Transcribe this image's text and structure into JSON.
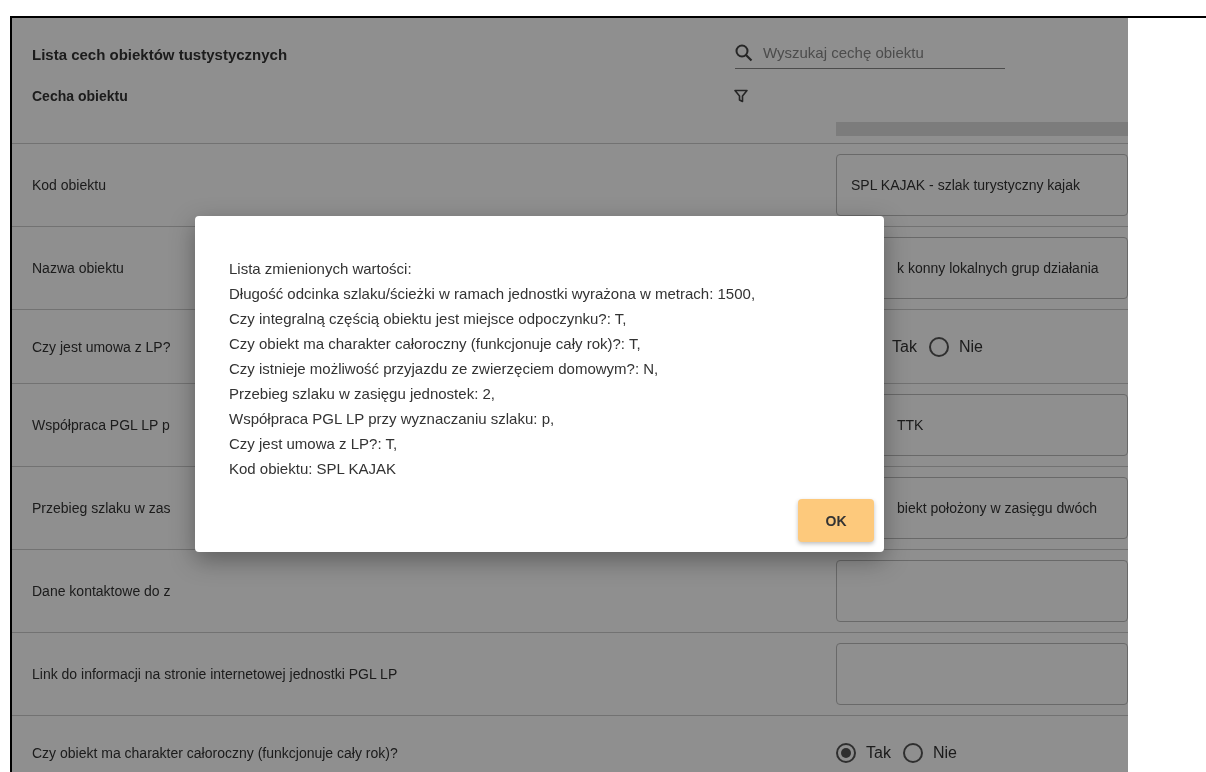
{
  "header": {
    "title": "Lista cech obiektów tustystycznych",
    "search": {
      "placeholder": "Wyszukaj cechę obiektu"
    }
  },
  "table": {
    "column": "Cecha obiektu",
    "rows": [
      {
        "kind": "field",
        "label": "Kod obiektu",
        "value": "SPL KAJAK - szlak turystyczny kajak"
      },
      {
        "kind": "field",
        "label": "Nazwa obiektu",
        "value": "k konny lokalnych grup działania"
      },
      {
        "kind": "radio",
        "label": "Czy jest umowa z LP?",
        "options": [
          {
            "label": "Tak"
          },
          {
            "label": "Nie",
            "selected": false
          }
        ]
      },
      {
        "kind": "field",
        "label": "Współpraca PGL LP p",
        "value": "TTK"
      },
      {
        "kind": "field",
        "label": "Przebieg szlaku w zas",
        "value": "biekt położony w zasięgu dwóch"
      },
      {
        "kind": "field",
        "label": "Dane kontaktowe do z"
      },
      {
        "kind": "field",
        "label": "Link do informacji na stronie internetowej jednostki PGL LP"
      },
      {
        "kind": "radio",
        "label": "Czy obiekt ma charakter całoroczny (funkcjonuje cały rok)?",
        "options": [
          {
            "label": "Tak",
            "selected": true
          },
          {
            "label": "Nie",
            "selected": false
          }
        ]
      }
    ]
  },
  "dialog": {
    "lines": [
      "Lista zmienionych wartości:",
      "Długość odcinka szlaku/ścieżki w ramach jednostki wyrażona w metrach: 1500,",
      "Czy integralną częścią obiektu jest miejsce odpoczynku?: T,",
      "Czy obiekt ma charakter całoroczny (funkcjonuje cały rok)?: T,",
      "Czy istnieje możliwość przyjazdu ze zwierzęciem domowym?: N,",
      "Przebieg szlaku w zasięgu jednostek: 2,",
      "Współpraca PGL LP przy wyznaczaniu szlaku: p,",
      "Czy jest umowa z LP?: T,",
      "Kod obiektu: SPL KAJAK"
    ],
    "button": "OK"
  }
}
